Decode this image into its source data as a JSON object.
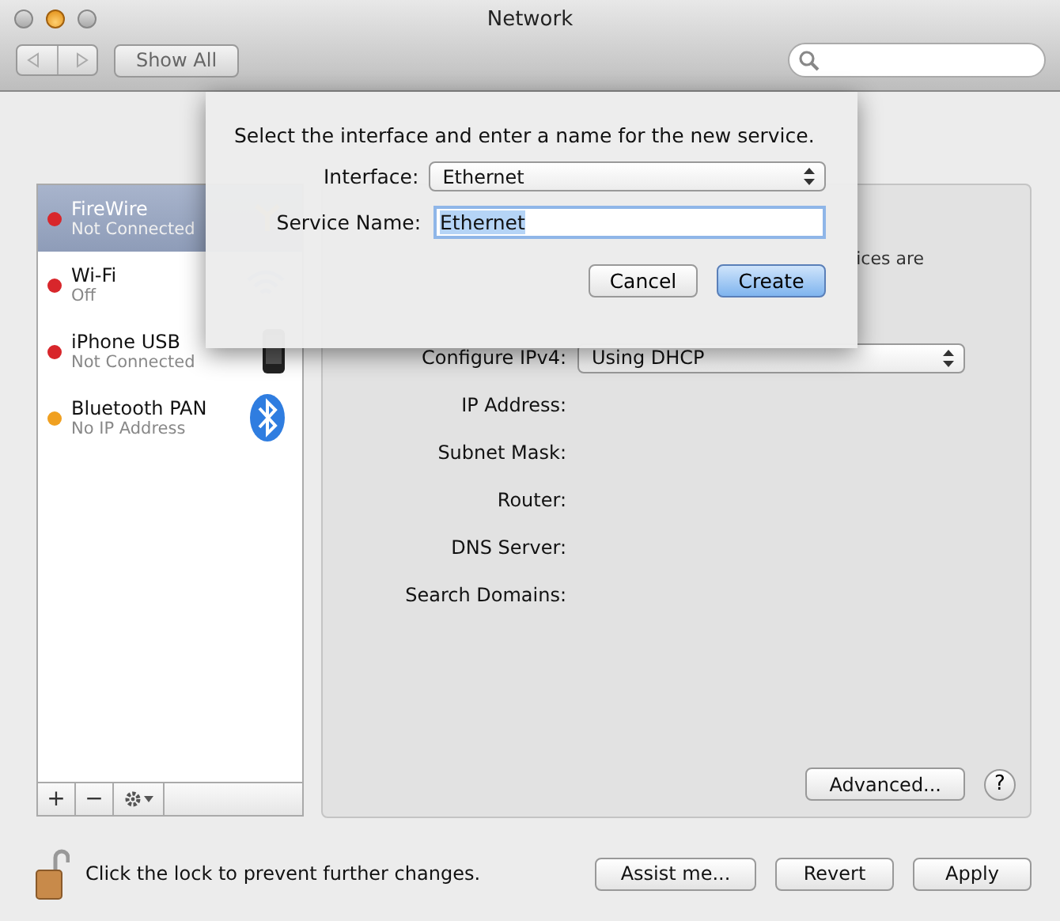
{
  "window": {
    "title": "Network"
  },
  "toolbar": {
    "show_all": "Show All"
  },
  "services": [
    {
      "name": "FireWire",
      "status": "Not Connected",
      "color": "#d8262b",
      "selected": true,
      "kind": "firewire"
    },
    {
      "name": "Wi-Fi",
      "status": "Off",
      "color": "#d8262b",
      "selected": false,
      "kind": "wifi"
    },
    {
      "name": "iPhone USB",
      "status": "Not Connected",
      "color": "#d8262b",
      "selected": false,
      "kind": "iphone"
    },
    {
      "name": "Bluetooth PAN",
      "status": "No IP Address",
      "color": "#f0a020",
      "selected": false,
      "kind": "bluetooth"
    }
  ],
  "list_buttons": [
    "+",
    "−"
  ],
  "panel": {
    "status_text": "ices are",
    "fields": [
      {
        "label": "Configure IPv4:",
        "kind": "dropdown",
        "value": "Using DHCP"
      },
      {
        "label": "IP Address:",
        "kind": "text"
      },
      {
        "label": "Subnet Mask:",
        "kind": "text"
      },
      {
        "label": "Router:",
        "kind": "text"
      },
      {
        "label": "DNS Server:",
        "kind": "text"
      },
      {
        "label": "Search Domains:",
        "kind": "text"
      }
    ],
    "advanced": "Advanced...",
    "help": "?"
  },
  "lock": {
    "text": "Click the lock to prevent further changes.",
    "locked": false
  },
  "buttons": [
    "Assist me...",
    "Revert",
    "Apply"
  ],
  "dialog": {
    "prompt": "Select the interface and enter a name for the new service.",
    "interface": {
      "label": "Interface:",
      "value": "Ethernet"
    },
    "service_name": {
      "label": "Service Name:",
      "value": "Ethernet",
      "text_selected": true
    },
    "buttons": [
      {
        "label": "Cancel",
        "default": false
      },
      {
        "label": "Create",
        "default": true
      }
    ]
  }
}
